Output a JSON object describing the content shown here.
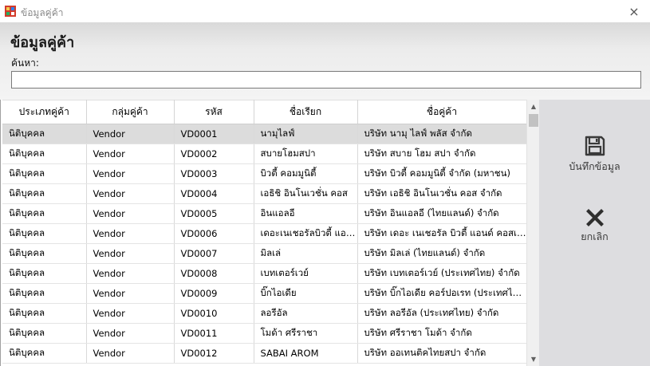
{
  "window": {
    "title": "ข้อมูลคู่ค้า",
    "close_icon": "×"
  },
  "header": {
    "title": "ข้อมูลคู่ค้า",
    "search_label": "ค้นหา:",
    "search_value": ""
  },
  "grid": {
    "columns": [
      "ประเภทคู่ค้า",
      "กลุ่มคู่ค้า",
      "รหัส",
      "ชื่อเรียก",
      "ชื่อคู่ค้า"
    ],
    "rows": [
      [
        "นิติบุคคล",
        "Vendor",
        "VD0001",
        "นามุไลฟ์",
        "บริษัท นามุ ไลฟ์ พลัส จำกัด"
      ],
      [
        "นิติบุคคล",
        "Vendor",
        "VD0002",
        "สบายโฮมสปา",
        "บริษัท สบาย โฮม สปา จำกัด"
      ],
      [
        "นิติบุคคล",
        "Vendor",
        "VD0003",
        "บิวตี้ คอมมูนิตี้",
        "บริษัท บิวตี้ คอมมูนิตี้ จำกัด (มหาชน)"
      ],
      [
        "นิติบุคคล",
        "Vendor",
        "VD0004",
        "เอธิชิ อินโนเวชั่น คอส",
        "บริษัท เอธิชิ อินโนเวชั่น คอส จำกัด"
      ],
      [
        "นิติบุคคล",
        "Vendor",
        "VD0005",
        "อินแอลอี",
        "บริษัท อินแอลอี (ไทยแลนด์) จำกัด"
      ],
      [
        "นิติบุคคล",
        "Vendor",
        "VD0006",
        "เดอะเนเชอรัลบิวตี้ แอน...",
        "บริษัท เดอะ เนเชอรัล บิวตี้ แอนด์ คอสเม..."
      ],
      [
        "นิติบุคคล",
        "Vendor",
        "VD0007",
        "มิลเล่",
        "บริษัท มิลเล่ (ไทยแลนด์) จำกัด"
      ],
      [
        "นิติบุคคล",
        "Vendor",
        "VD0008",
        "เบทเตอร์เวย์",
        "บริษัท เบทเตอร์เวย์ (ประเทศไทย) จำกัด"
      ],
      [
        "นิติบุคคล",
        "Vendor",
        "VD0009",
        "บิ๊กไอเดีย",
        "บริษัท บิ๊กไอเดีย คอร์ปอเรท (ประเทศไท..."
      ],
      [
        "นิติบุคคล",
        "Vendor",
        "VD0010",
        "ลอรีอัล",
        "บริษัท ลอรีอัล (ประเทศไทย) จำกัด"
      ],
      [
        "นิติบุคคล",
        "Vendor",
        "VD0011",
        "โมด้า ศรีราชา",
        "บริษัท ศรีราชา โมด้า จำกัด"
      ],
      [
        "นิติบุคคล",
        "Vendor",
        "VD0012",
        "SABAI AROM",
        "บริษัท ออเทนติคไทยสปา จำกัด"
      ]
    ],
    "selected_row": 0
  },
  "actions": {
    "save_label": "บันทึกข้อมูล",
    "cancel_label": "ยกเลิก",
    "save_icon": "floppy-disk-icon",
    "cancel_icon": "x-mark-icon"
  },
  "colors": {
    "side_panel": "#dddde0",
    "selected_row": "#dcdcdc"
  }
}
